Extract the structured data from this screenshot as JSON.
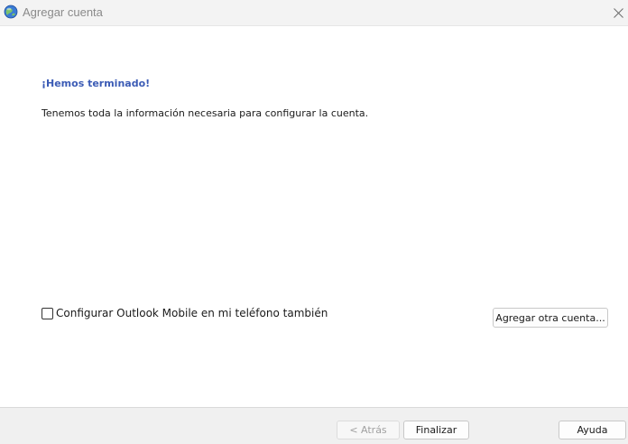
{
  "window": {
    "title": "Agregar cuenta",
    "icon": "outlook-globe-icon",
    "close_icon": "close-icon"
  },
  "main": {
    "heading": "¡Hemos terminado!",
    "description": "Tenemos toda la información necesaria para configurar la cuenta.",
    "mobile_checkbox": {
      "label": "Configurar Outlook Mobile en mi teléfono también",
      "checked": false
    },
    "add_account_label": "Agregar otra cuenta..."
  },
  "footer": {
    "back_label": "< Atrás",
    "back_enabled": false,
    "finish_label": "Finalizar",
    "help_label": "Ayuda"
  },
  "colors": {
    "heading": "#3b5bb5",
    "title_text": "#8a8a8a",
    "footer_bg": "#f0f0f0",
    "titlebar_bg": "#f3f3f3"
  }
}
